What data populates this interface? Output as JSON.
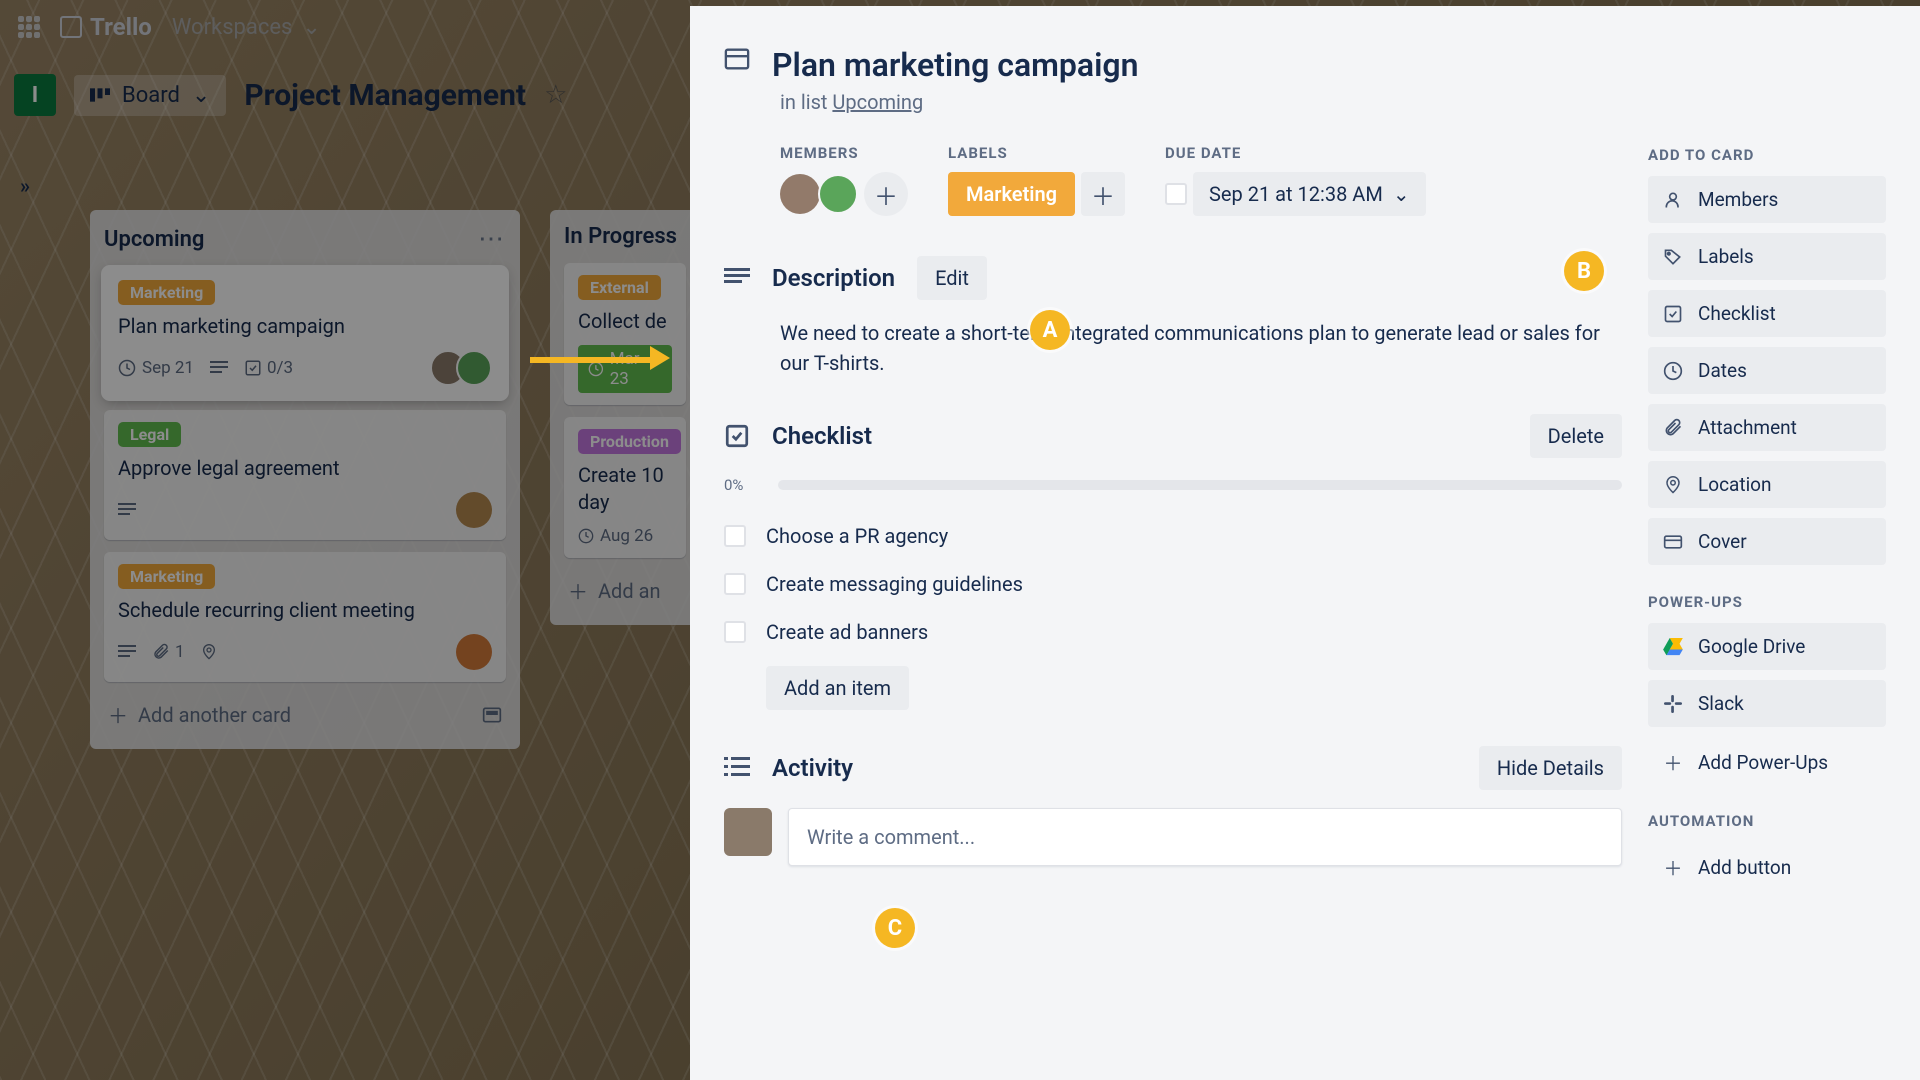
{
  "header": {
    "logo": "Trello",
    "workspaces": "Workspaces"
  },
  "board": {
    "workspace_letter": "I",
    "view_label": "Board",
    "title": "Project Management"
  },
  "lists": [
    {
      "title": "Upcoming",
      "cards": [
        {
          "label": "Marketing",
          "title": "Plan marketing campaign",
          "date": "Sep 21",
          "checklist": "0/3"
        },
        {
          "label": "Legal",
          "title": "Approve legal agreement"
        },
        {
          "label": "Marketing",
          "title": "Schedule recurring client meeting",
          "attach": "1"
        }
      ],
      "add": "Add another card"
    },
    {
      "title": "In Progress",
      "cards": [
        {
          "label": "External",
          "title": "Collect de",
          "date": "Mar 23"
        },
        {
          "label": "Production",
          "title": "Create 10 day",
          "date": "Aug 26"
        }
      ],
      "add": "Add an"
    }
  ],
  "modal": {
    "title": "Plan marketing campaign",
    "in_list_prefix": "in list ",
    "in_list_link": "Upcoming",
    "members_h": "MEMBERS",
    "labels_h": "LABELS",
    "label_value": "Marketing",
    "due_h": "DUE DATE",
    "due_value": "Sep 21 at 12:38 AM",
    "desc_h": "Description",
    "desc_edit": "Edit",
    "desc_body": "We need to create a short-term integrated communications plan to generate lead or sales for our T-shirts.",
    "checklist_h": "Checklist",
    "checklist_delete": "Delete",
    "checklist_pct": "0%",
    "checklist_items": [
      "Choose a PR agency",
      "Create messaging guidelines",
      "Create ad banners"
    ],
    "checklist_add": "Add an item",
    "activity_h": "Activity",
    "activity_hide": "Hide Details",
    "comment_placeholder": "Write a comment...",
    "side": {
      "add_h": "ADD TO CARD",
      "members": "Members",
      "labels": "Labels",
      "checklist": "Checklist",
      "dates": "Dates",
      "attachment": "Attachment",
      "location": "Location",
      "cover": "Cover",
      "powerups_h": "POWER-UPS",
      "gdrive": "Google Drive",
      "slack": "Slack",
      "add_powerup": "Add Power-Ups",
      "automation_h": "AUTOMATION",
      "add_button": "Add button"
    }
  },
  "annotations": {
    "a": "A",
    "b": "B",
    "c": "C"
  }
}
